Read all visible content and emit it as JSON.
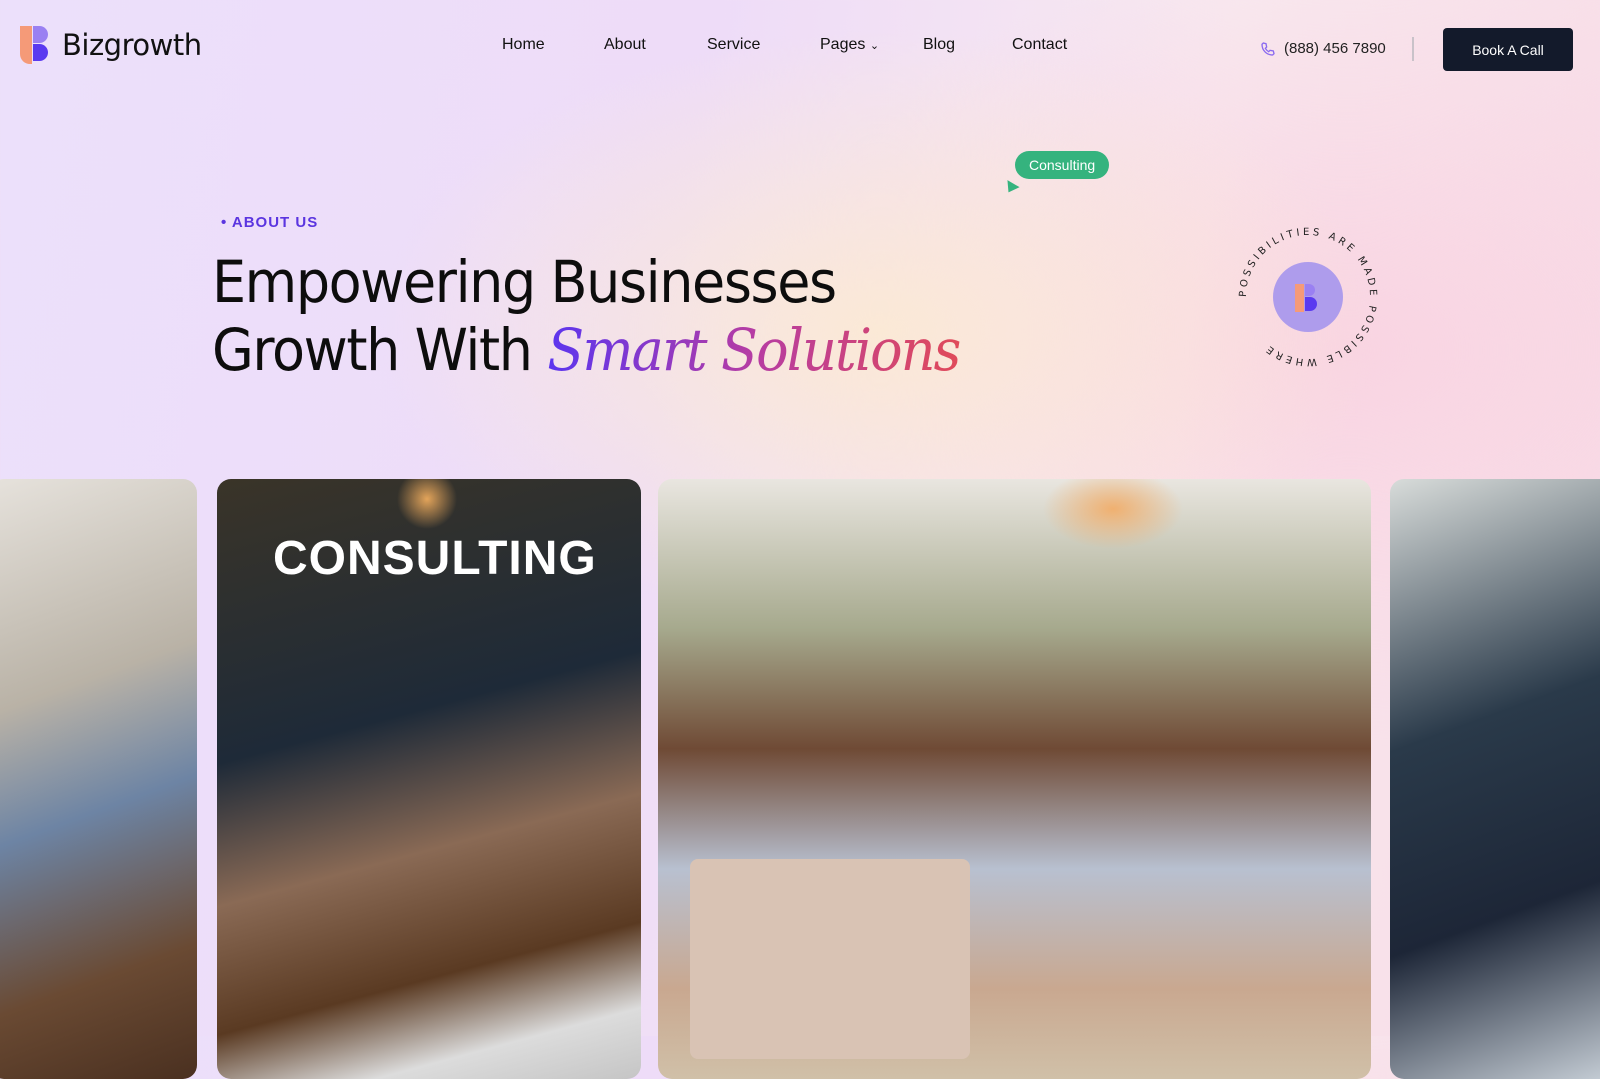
{
  "brand": {
    "name": "Bizgrowth"
  },
  "nav": {
    "items": [
      {
        "label": "Home"
      },
      {
        "label": "About"
      },
      {
        "label": "Service"
      },
      {
        "label": "Pages",
        "caret": "⌄"
      },
      {
        "label": "Blog"
      },
      {
        "label": "Contact"
      }
    ]
  },
  "header": {
    "phone": "(888) 456 7890",
    "cta": "Book A Call"
  },
  "hero": {
    "badge": "Consulting",
    "eyebrow": "ABOUT US",
    "title_line1": "Empowering Businesses",
    "title_line2_plain": "Growth With ",
    "title_line2_accent": "Smart Solutions",
    "ring_text": "POSSIBILITIES ARE MADE POSSIBLE WHERE "
  },
  "gallery": {
    "card2_caption": "CONSULTING"
  },
  "colors": {
    "accent": "#5b35e0",
    "badge": "#35b37e",
    "button": "#131a2b"
  }
}
